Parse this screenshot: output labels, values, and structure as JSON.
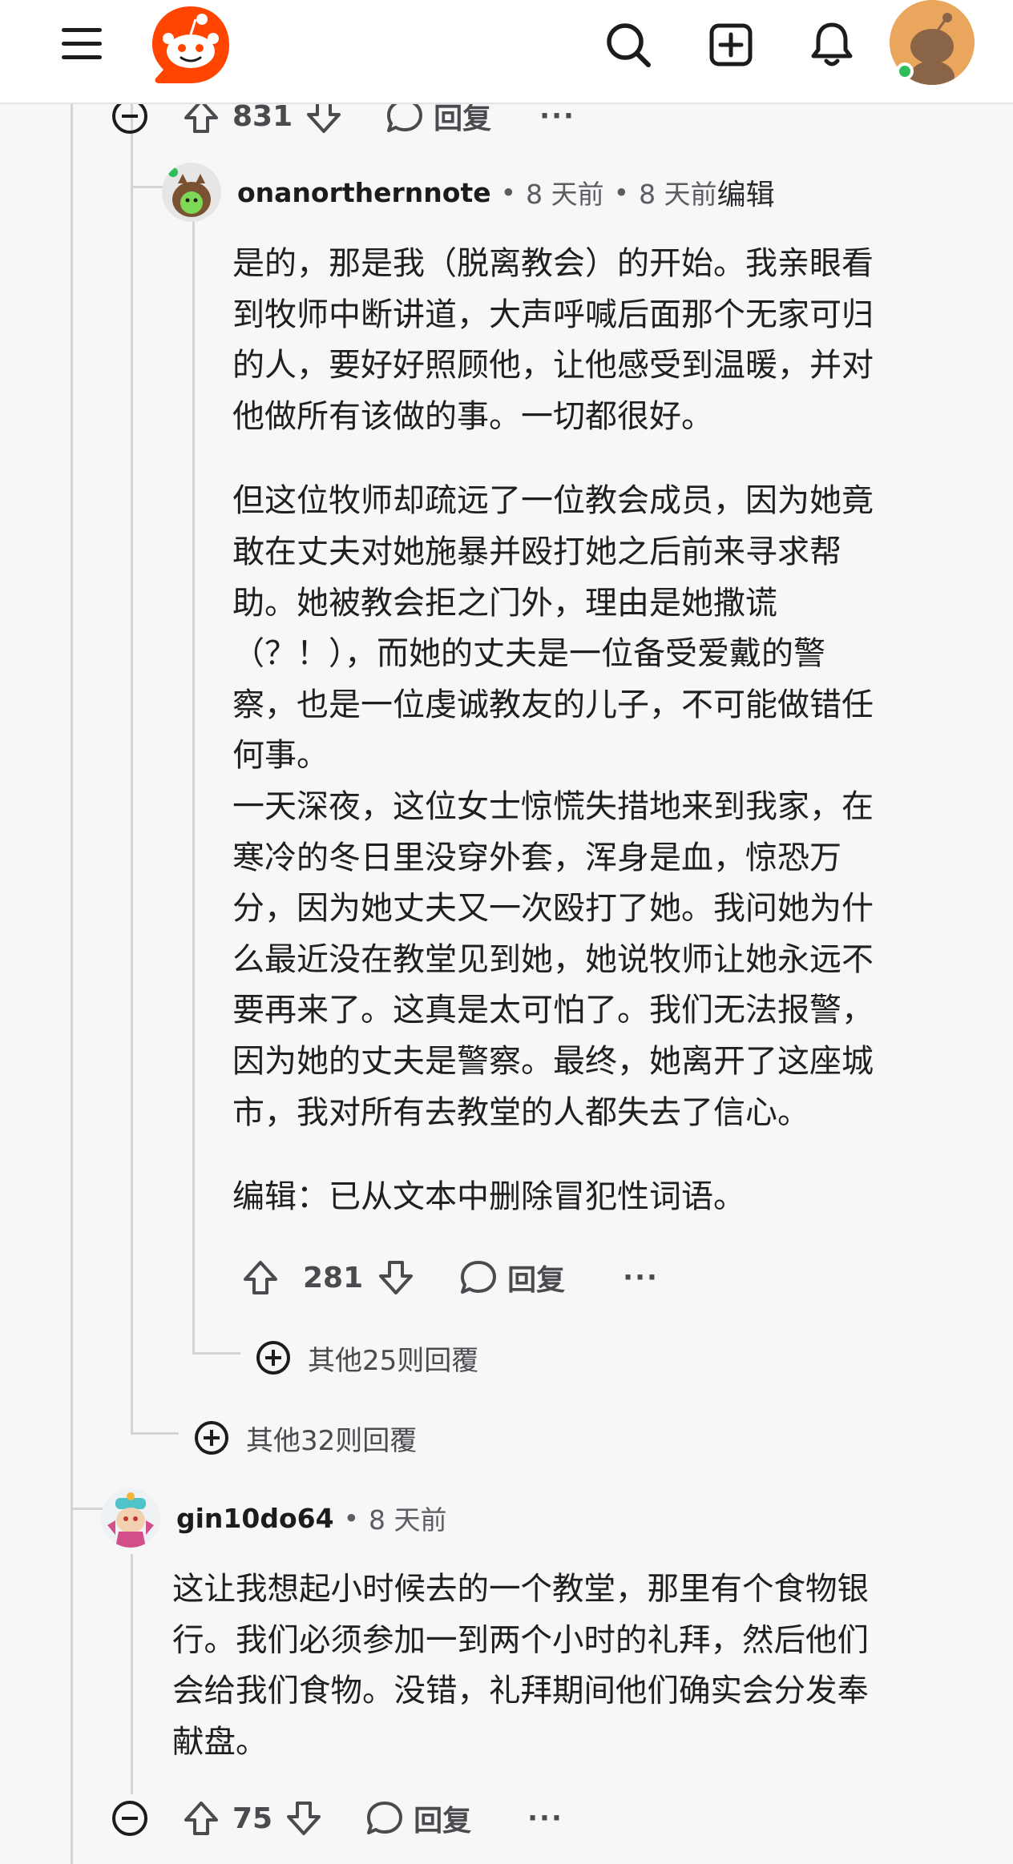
{
  "header": {
    "menu_icon": "hamburger-menu-icon",
    "logo_icon": "reddit-snoo-logo",
    "search_icon": "search-icon",
    "create_icon": "plus-square-icon",
    "notifications_icon": "bell-icon",
    "profile_icon": "user-avatar"
  },
  "top_comment_actions": {
    "upvotes": "831",
    "reply_label": "回复",
    "more": "···"
  },
  "comment1": {
    "username": "onanorthernnote",
    "sep1": "•",
    "age": "8 天前",
    "sep2": "•",
    "edited_age": "8 天前",
    "edited_label": "编辑",
    "para1": "是的，那是我（脱离教会）的开始。我亲眼看\n到牧师中断讲道，大声呼喊后面那个无家可归\n的人，要好好照顾他，让他感受到温暖，并对\n他做所有该做的事。一切都很好。",
    "para2": "但这位牧师却疏远了一位教会成员，因为她竟\n敢在丈夫对她施暴并殴打她之后前来寻求帮\n助。她被教会拒之门外，理由是她撒谎\n（？！），而她的丈夫是一位备受爱戴的警\n察，也是一位虔诚教友的儿子，不可能做错任\n何事。\n一天深夜，这位女士惊慌失措地来到我家，在\n寒冷的冬日里没穿外套，浑身是血，惊恐万\n分，因为她丈夫又一次殴打了她。我问她为什\n么最近没在教堂见到她，她说牧师让她永远不\n要再来了。这真是太可怕了。我们无法报警，\n因为她的丈夫是警察。最终，她离开了这座城\n市，我对所有去教堂的人都失去了信心。",
    "para3": "编辑：已从文本中删除冒犯性词语。",
    "upvotes": "281",
    "reply_label": "回复",
    "more": "···",
    "more_replies": "其他25则回覆"
  },
  "more_replies_outer": "其他32则回覆",
  "comment2": {
    "username": "gin10do64",
    "sep1": "•",
    "age": "8 天前",
    "body": "这让我想起小时候去的一个教堂，那里有个食物银\n行。我们必须参加一到两个小时的礼拜，然后他们\n会给我们食物。没错，礼拜期间他们确实会分发奉\n献盘。",
    "upvotes": "75",
    "reply_label": "回复",
    "more": "···"
  },
  "colors": {
    "brand": "#ff4500",
    "online": "#2dbd5a",
    "thread_line": "#d4d4d8"
  }
}
